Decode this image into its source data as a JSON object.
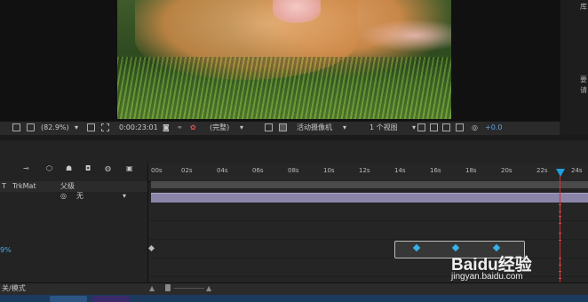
{
  "viewer": {
    "zoom": "(82.9%)",
    "timecode": "0:00:23:01",
    "resolution": "(完整)",
    "camera": "活动摄像机",
    "views": "1 个视图",
    "exposure": "+0.0"
  },
  "side_panel": {
    "title": "库",
    "text_1": "要",
    "text_2": "请"
  },
  "timeline": {
    "ruler_ticks": [
      "00s",
      "02s",
      "04s",
      "06s",
      "08s",
      "10s",
      "12s",
      "14s",
      "16s",
      "18s",
      "20s",
      "22s",
      "24s"
    ],
    "col_t": "T",
    "col_trkmat": "TrkMat",
    "col_parent": "父级",
    "parent_value": "无",
    "property_value": "9%",
    "bottom_label": "关/模式"
  },
  "watermark": {
    "brand": "Baidu经验",
    "url": "jingyan.baidu.com"
  },
  "colors": {
    "keyframe": "#3ab0e8",
    "layer_bar": "#8a85a8",
    "time_indicator": "#1e9fe0",
    "cti_line": "#cc3333"
  },
  "icons": [
    "monitor-icon",
    "region-icon",
    "camera-icon",
    "channel-icon",
    "grid-icon",
    "fast-preview-icon",
    "flowchart-icon",
    "reset-exposure-icon",
    "cti-icon",
    "keyframe-icon"
  ]
}
